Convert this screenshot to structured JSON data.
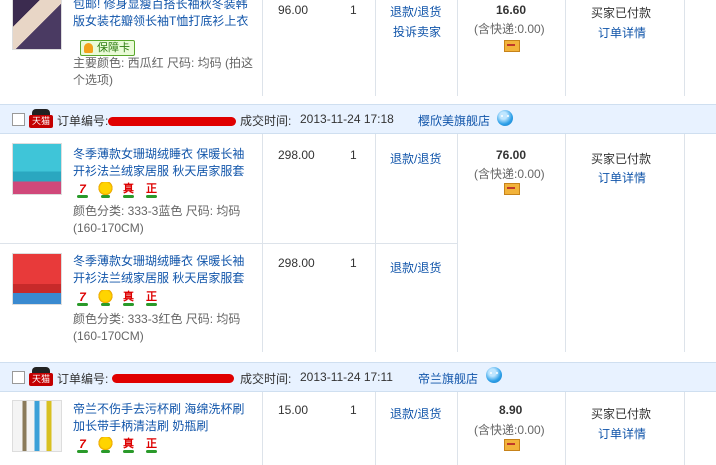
{
  "top_item": {
    "title": "包邮! 修身显瘦百搭长袖秋冬装韩版女装花瓣领长袖T恤打底衫上衣",
    "badge_label": "保障卡",
    "attrs": "主要颜色: 西瓜红 尺码: 均码 (拍这个选项)",
    "price": "96.00",
    "qty": "1",
    "refund": "退款/退货",
    "complain": "投诉卖家",
    "total": "16.60",
    "shipping": "(含快递:0.00)",
    "status": "买家已付款",
    "detail": "订单详情"
  },
  "orders": [
    {
      "tag": "天猫",
      "order_no_label": "订单编号:",
      "time_label": "成交时间:",
      "time": "2013-11-24 17:18",
      "shop": "樱欣美旗舰店",
      "total": "76.00",
      "shipping": "(含快递:0.00)",
      "status": "买家已付款",
      "detail": "订单详情",
      "items": [
        {
          "title": "冬季薄款女珊瑚绒睡衣 保暖长袖开衫法兰绒家居服 秋天居家服套",
          "attrs": "颜色分类: 333-3蓝色 尺码: 均码(160-170CM)",
          "price": "298.00",
          "qty": "1",
          "refund": "退款/退货",
          "badges": [
            "7",
            "金币",
            "真",
            "正"
          ]
        },
        {
          "title": "冬季薄款女珊瑚绒睡衣 保暖长袖开衫法兰绒家居服 秋天居家服套",
          "attrs": "颜色分类: 333-3红色 尺码: 均码(160-170CM)",
          "price": "298.00",
          "qty": "1",
          "refund": "退款/退货",
          "badges": [
            "7",
            "金币",
            "真",
            "正"
          ]
        }
      ]
    },
    {
      "tag": "天猫",
      "order_no_label": "订单编号:",
      "time_label": "成交时间:",
      "time": "2013-11-24 17:11",
      "shop": "帝兰旗舰店",
      "total": "8.90",
      "shipping": "(含快递:0.00)",
      "status": "买家已付款",
      "detail": "订单详情",
      "items": [
        {
          "title": "帝兰不伤手去污杯刷 海绵洗杯刷加长带手柄清洁刷 奶瓶刷",
          "price": "15.00",
          "qty": "1",
          "refund": "退款/退货",
          "badges": [
            "7",
            "金币",
            "真",
            "正"
          ]
        }
      ]
    }
  ],
  "colors": {
    "link": "#1155aa",
    "header_bg": "#e8f2ff",
    "redaction": "#e00000",
    "tmall_red": "#c40000"
  },
  "icons": [
    "tmall-icon",
    "wangwang-icon",
    "payment-card-icon",
    "seven-day-return-icon",
    "gold-coin-icon",
    "genuine-icon",
    "authentic-icon",
    "guarantee-card-icon"
  ]
}
